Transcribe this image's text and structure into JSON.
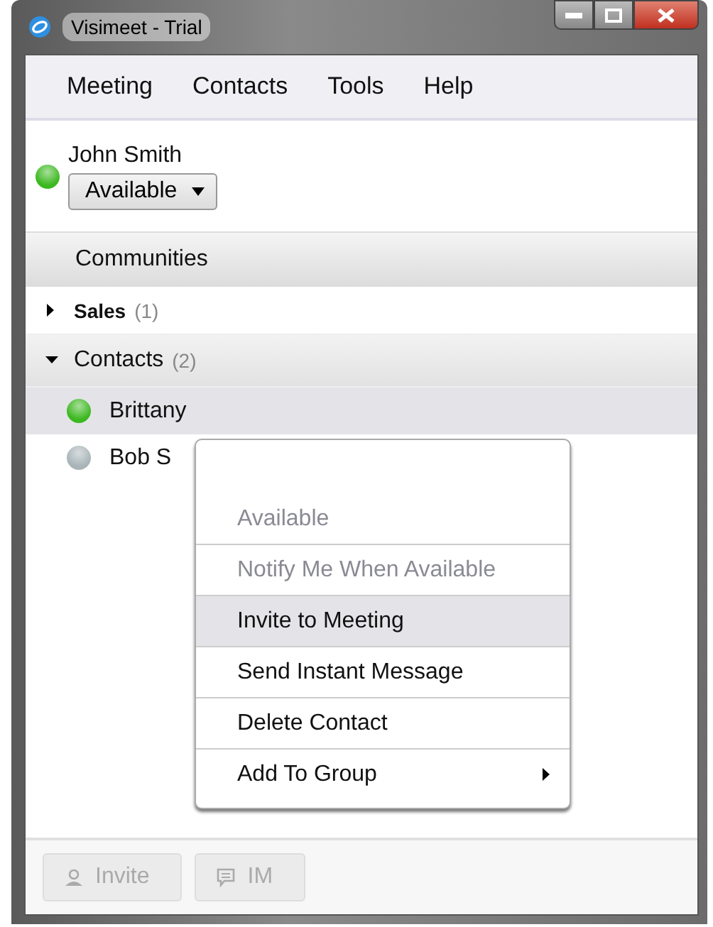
{
  "window": {
    "title": "Visimeet - Trial"
  },
  "menu_bar": [
    "Meeting",
    "Contacts",
    "Tools",
    "Help"
  ],
  "user": {
    "name": "John Smith",
    "color": "#3cb820",
    "status_dropdown": "Available"
  },
  "communities": {
    "title": "Communities",
    "groups": [
      {
        "name": "Sales",
        "count": "(1)",
        "expanded": false
      }
    ]
  },
  "contacts": {
    "title": "Contacts",
    "count": "(2)",
    "expanded": true,
    "items": [
      {
        "name": "Brittany",
        "color": "#3cb820",
        "selected": true
      },
      {
        "name": "Bob S",
        "color": "#a8b4b8",
        "selected": false
      }
    ]
  },
  "context_menu": [
    {
      "label": "Available",
      "disabled": true,
      "selected": false,
      "submenu": false
    },
    {
      "label": "Notify Me When Available",
      "disabled": true,
      "selected": false,
      "submenu": false
    },
    {
      "label": "Invite to Meeting",
      "disabled": false,
      "selected": true,
      "submenu": false
    },
    {
      "label": "Send Instant Message",
      "disabled": false,
      "selected": false,
      "submenu": false
    },
    {
      "label": "Delete Contact",
      "disabled": false,
      "selected": false,
      "submenu": false
    },
    {
      "label": "Add To Group",
      "disabled": false,
      "selected": false,
      "submenu": true
    }
  ],
  "buttons": [
    {
      "label": "Invite",
      "kind": "person",
      "disabled": true
    },
    {
      "label": "IM",
      "kind": "chat",
      "disabled": true
    }
  ]
}
